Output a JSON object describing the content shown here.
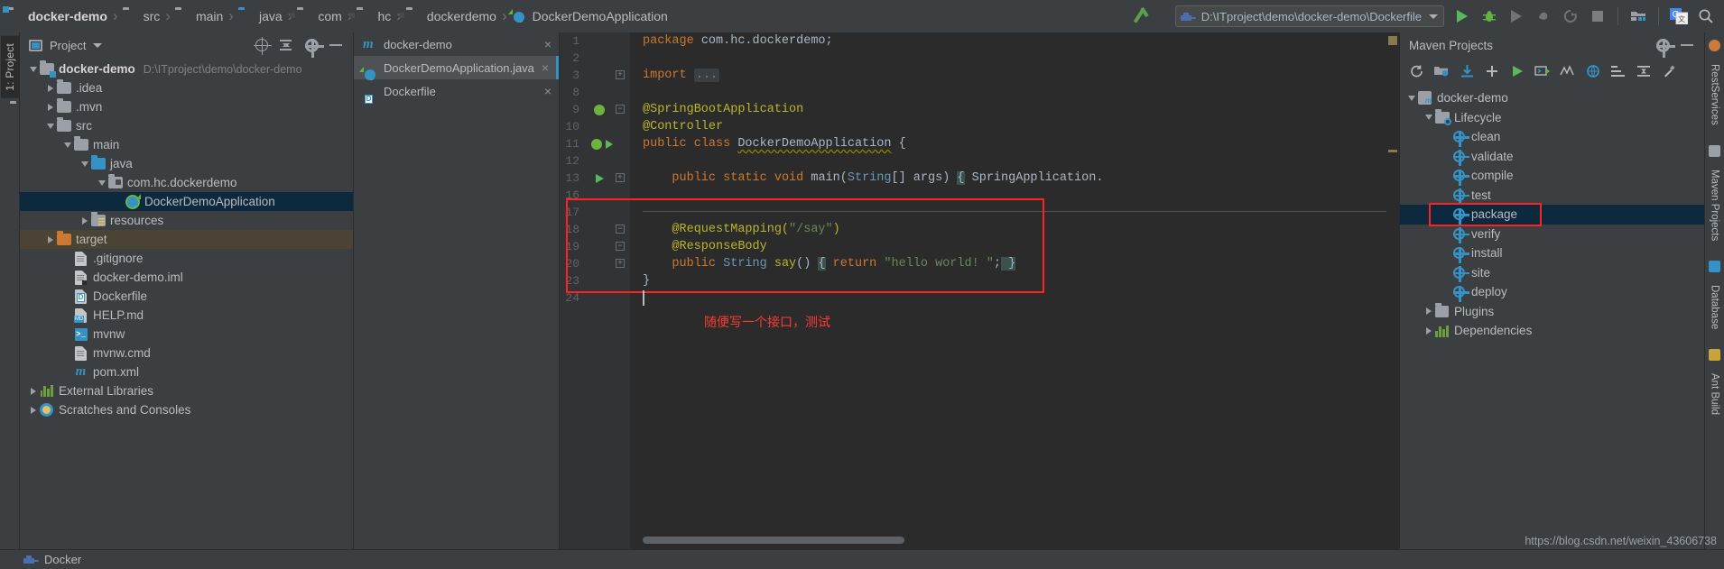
{
  "navbar": {
    "breadcrumbs": [
      {
        "label": "docker-demo",
        "icon": "project-folder-icon",
        "bold": true
      },
      {
        "label": "src",
        "icon": "folder-icon",
        "bold": false
      },
      {
        "label": "main",
        "icon": "folder-icon",
        "bold": false
      },
      {
        "label": "java",
        "icon": "source-folder-icon",
        "bold": false
      },
      {
        "label": "com",
        "icon": "package-icon",
        "bold": false
      },
      {
        "label": "hc",
        "icon": "package-icon",
        "bold": false
      },
      {
        "label": "dockerdemo",
        "icon": "package-icon",
        "bold": false
      },
      {
        "label": "DockerDemoApplication",
        "icon": "spring-class-icon",
        "bold": false
      }
    ],
    "run_config": {
      "value": "D:\\ITproject\\demo\\docker-demo\\Dockerfile",
      "icon": "docker-icon"
    },
    "toolbar_icons": [
      {
        "name": "run-icon",
        "enabled": true
      },
      {
        "name": "debug-icon",
        "enabled": true
      },
      {
        "name": "run-with-coverage-icon",
        "enabled": false
      },
      {
        "name": "profile-icon",
        "enabled": false
      },
      {
        "name": "rerun-icon",
        "enabled": false
      },
      {
        "name": "stop-icon",
        "enabled": false
      },
      {
        "name": "project-structure-icon",
        "enabled": true
      },
      {
        "name": "translate-icon",
        "enabled": true
      },
      {
        "name": "search-everywhere-icon",
        "enabled": true
      }
    ]
  },
  "left_strip": {
    "tab_label": "1: Project",
    "bottom_icon": "folder-icon"
  },
  "project_panel": {
    "title": "Project",
    "actions": [
      "locate-icon",
      "collapse-all-icon",
      "settings-icon",
      "hide-icon"
    ],
    "tree": [
      {
        "label": "docker-demo",
        "path": "D:\\ITproject\\demo\\docker-demo",
        "depth": 0,
        "twisty": "down",
        "icon": "project-folder-icon",
        "bold": true,
        "state": "none"
      },
      {
        "label": ".idea",
        "depth": 1,
        "twisty": "right",
        "icon": "folder-icon",
        "state": "none"
      },
      {
        "label": ".mvn",
        "depth": 1,
        "twisty": "right",
        "icon": "folder-icon",
        "state": "none"
      },
      {
        "label": "src",
        "depth": 1,
        "twisty": "down",
        "icon": "folder-icon",
        "state": "none"
      },
      {
        "label": "main",
        "depth": 2,
        "twisty": "down",
        "icon": "folder-icon",
        "state": "none"
      },
      {
        "label": "java",
        "depth": 3,
        "twisty": "down",
        "icon": "source-folder-icon",
        "state": "none"
      },
      {
        "label": "com.hc.dockerdemo",
        "depth": 4,
        "twisty": "down",
        "icon": "package-icon",
        "state": "none"
      },
      {
        "label": "DockerDemoApplication",
        "depth": 5,
        "twisty": "none",
        "icon": "spring-class-icon",
        "state": "selected"
      },
      {
        "label": "resources",
        "depth": 3,
        "twisty": "right",
        "icon": "resources-folder-icon",
        "state": "none"
      },
      {
        "label": "target",
        "depth": 1,
        "twisty": "right",
        "icon": "excluded-folder-icon",
        "state": "target"
      },
      {
        "label": ".gitignore",
        "depth": 2,
        "twisty": "none",
        "icon": "text-file-icon",
        "state": "none"
      },
      {
        "label": "docker-demo.iml",
        "depth": 2,
        "twisty": "none",
        "icon": "iml-file-icon",
        "state": "none"
      },
      {
        "label": "Dockerfile",
        "depth": 2,
        "twisty": "none",
        "icon": "dockerfile-icon",
        "state": "none"
      },
      {
        "label": "HELP.md",
        "depth": 2,
        "twisty": "none",
        "icon": "markdown-file-icon",
        "state": "none"
      },
      {
        "label": "mvnw",
        "depth": 2,
        "twisty": "none",
        "icon": "shell-script-icon",
        "state": "none"
      },
      {
        "label": "mvnw.cmd",
        "depth": 2,
        "twisty": "none",
        "icon": "text-file-icon",
        "state": "none"
      },
      {
        "label": "pom.xml",
        "depth": 2,
        "twisty": "none",
        "icon": "maven-pom-icon",
        "state": "none"
      },
      {
        "label": "External Libraries",
        "depth": 0,
        "twisty": "right",
        "icon": "libraries-icon",
        "state": "none"
      },
      {
        "label": "Scratches and Consoles",
        "depth": 0,
        "twisty": "right",
        "icon": "scratches-icon",
        "state": "none"
      }
    ]
  },
  "editor": {
    "tabs": [
      {
        "label": "docker-demo",
        "icon": "maven-pom-icon",
        "active": false,
        "closable": true
      },
      {
        "label": "DockerDemoApplication.java",
        "icon": "spring-class-icon",
        "active": true,
        "closable": true
      },
      {
        "label": "Dockerfile",
        "icon": "dockerfile-icon",
        "active": false,
        "closable": true
      }
    ],
    "line_numbers": [
      "1",
      "2",
      "3",
      "8",
      "9",
      "10",
      "11",
      "12",
      "13",
      "16",
      "17",
      "18",
      "19",
      "20",
      "23",
      "24"
    ],
    "code_lines": [
      {
        "n": "1",
        "tokens": [
          {
            "t": "package ",
            "c": "kw"
          },
          {
            "t": "com.hc.dockerdemo;",
            "c": "plain"
          }
        ]
      },
      {
        "n": "2",
        "tokens": []
      },
      {
        "n": "3",
        "tokens": [
          {
            "t": "import ",
            "c": "kw"
          },
          {
            "t": "...",
            "c": "fold"
          }
        ]
      },
      {
        "n": "8",
        "tokens": []
      },
      {
        "n": "9",
        "tokens": [
          {
            "t": "@SpringBootApplication",
            "c": "ann"
          }
        ]
      },
      {
        "n": "10",
        "tokens": [
          {
            "t": "@Controller",
            "c": "ann"
          }
        ]
      },
      {
        "n": "11",
        "tokens": [
          {
            "t": "public ",
            "c": "kw"
          },
          {
            "t": "class ",
            "c": "kw"
          },
          {
            "t": "DockerDemoApplication",
            "c": "wavy"
          },
          {
            "t": " {",
            "c": "plain"
          }
        ]
      },
      {
        "n": "12",
        "tokens": []
      },
      {
        "n": "13",
        "tokens": [
          {
            "t": "    public ",
            "c": "kw"
          },
          {
            "t": "static ",
            "c": "kw"
          },
          {
            "t": "void ",
            "c": "kw"
          },
          {
            "t": "main",
            "c": "plain"
          },
          {
            "t": "(",
            "c": "plain"
          },
          {
            "t": "String",
            "c": "typ"
          },
          {
            "t": "[] args) ",
            "c": "plain"
          },
          {
            "t": "{",
            "c": "brace"
          },
          {
            "t": " SpringApplication.",
            "c": "plain"
          }
        ]
      },
      {
        "n": "16",
        "tokens": []
      },
      {
        "n": "17",
        "tokens": []
      },
      {
        "n": "18",
        "tokens": [
          {
            "t": "    @RequestMapping(",
            "c": "ann"
          },
          {
            "t": "\"/say\"",
            "c": "str"
          },
          {
            "t": ")",
            "c": "ann"
          }
        ]
      },
      {
        "n": "19",
        "tokens": [
          {
            "t": "    @ResponseBody",
            "c": "ann"
          }
        ]
      },
      {
        "n": "20",
        "tokens": [
          {
            "t": "    public ",
            "c": "kw"
          },
          {
            "t": "String ",
            "c": "typ"
          },
          {
            "t": "say",
            "c": "mth"
          },
          {
            "t": "() ",
            "c": "plain"
          },
          {
            "t": "{",
            "c": "brace"
          },
          {
            "t": " return ",
            "c": "kw"
          },
          {
            "t": "\"hello world! \"",
            "c": "str"
          },
          {
            "t": ";",
            "c": "plain"
          },
          {
            "t": " }",
            "c": "brace"
          }
        ]
      },
      {
        "n": "23",
        "tokens": [
          {
            "t": "}",
            "c": "plain"
          }
        ]
      },
      {
        "n": "24",
        "tokens": []
      }
    ],
    "gutter_marks": [
      {
        "line": "9",
        "icon": "spring-bean-icon"
      },
      {
        "line": "11",
        "icon": "spring-run-icon"
      },
      {
        "line": "13",
        "icon": "run-gutter-icon"
      }
    ],
    "annotation": {
      "text": "随便写一个接口，测试",
      "color": "#ff3b30"
    },
    "highlight_box_color": "#ff2222"
  },
  "maven_panel": {
    "title": "Maven Projects",
    "header_actions": [
      "settings-icon",
      "hide-icon"
    ],
    "toolbar_icons": [
      "reimport-icon",
      "generate-sources-icon",
      "download-sources-icon",
      "add-maven-project-icon",
      "run-maven-build-icon",
      "execute-goal-icon",
      "toggle-skip-tests-icon",
      "toggle-offline-icon",
      "show-dependencies-icon",
      "collapse-all-icon",
      "maven-settings-icon"
    ],
    "tree": [
      {
        "label": "docker-demo",
        "depth": 0,
        "twisty": "down",
        "icon": "maven-project-icon",
        "state": "none"
      },
      {
        "label": "Lifecycle",
        "depth": 1,
        "twisty": "down",
        "icon": "lifecycle-folder-icon",
        "state": "none"
      },
      {
        "label": "clean",
        "depth": 2,
        "twisty": "none",
        "icon": "maven-goal-icon",
        "state": "none"
      },
      {
        "label": "validate",
        "depth": 2,
        "twisty": "none",
        "icon": "maven-goal-icon",
        "state": "none"
      },
      {
        "label": "compile",
        "depth": 2,
        "twisty": "none",
        "icon": "maven-goal-icon",
        "state": "none"
      },
      {
        "label": "test",
        "depth": 2,
        "twisty": "none",
        "icon": "maven-goal-icon",
        "state": "none"
      },
      {
        "label": "package",
        "depth": 2,
        "twisty": "none",
        "icon": "maven-goal-icon",
        "state": "selected"
      },
      {
        "label": "verify",
        "depth": 2,
        "twisty": "none",
        "icon": "maven-goal-icon",
        "state": "none"
      },
      {
        "label": "install",
        "depth": 2,
        "twisty": "none",
        "icon": "maven-goal-icon",
        "state": "none"
      },
      {
        "label": "site",
        "depth": 2,
        "twisty": "none",
        "icon": "maven-goal-icon",
        "state": "none"
      },
      {
        "label": "deploy",
        "depth": 2,
        "twisty": "none",
        "icon": "maven-goal-icon",
        "state": "none"
      },
      {
        "label": "Plugins",
        "depth": 1,
        "twisty": "right",
        "icon": "plugins-folder-icon",
        "state": "none"
      },
      {
        "label": "Dependencies",
        "depth": 1,
        "twisty": "right",
        "icon": "dependencies-icon",
        "state": "none"
      }
    ]
  },
  "right_strip": {
    "tabs": [
      "RestServices",
      "Maven Projects",
      "Database",
      "Ant Build"
    ]
  },
  "status_bar": {
    "docker_label": "Docker"
  },
  "watermark": "https://blog.csdn.net/weixin_43606738"
}
